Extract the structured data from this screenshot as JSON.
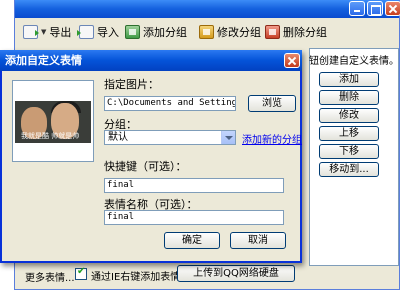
{
  "main_window": {
    "toolbar": {
      "export_label": "导出",
      "import_label": "导入",
      "add_group_label": "添加分组",
      "edit_group_label": "修改分组",
      "delete_group_label": "删除分组"
    },
    "hint_text": "钮创建自定义表情。",
    "side_buttons": {
      "add": "添加",
      "delete": "删除",
      "edit": "修改",
      "move_up": "上移",
      "move_down": "下移",
      "move_to": "移动到..."
    },
    "bottom": {
      "more_label": "更多表情...",
      "ie_checkbox_label": "通过IE右键添加表情",
      "ie_checkbox_checked": true,
      "upload_label": "上传到QQ网络硬盘"
    }
  },
  "dialog": {
    "title": "添加自定义表情",
    "preview_caption": "我就是酷  帅就是帅",
    "image_label": "指定图片：",
    "image_path": "C:\\Documents and Settings\\Ge\\",
    "browse_label": "浏览",
    "group_label": "分组：",
    "group_value": "默认",
    "add_group_link": "添加新的分组",
    "shortcut_label": "快捷键（可选）：",
    "shortcut_value": "final",
    "name_label": "表情名称（可选）：",
    "name_value": "final",
    "ok_label": "确定",
    "cancel_label": "取消"
  }
}
